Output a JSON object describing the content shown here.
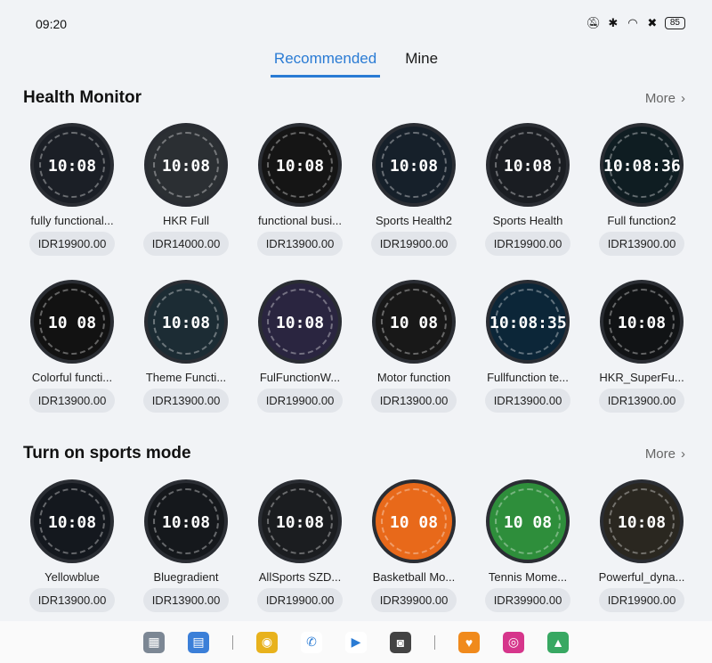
{
  "status": {
    "time": "09:20",
    "battery": "85"
  },
  "tabs": [
    {
      "label": "Recommended"
    },
    {
      "label": "Mine"
    }
  ],
  "sections": [
    {
      "title": "Health Monitor",
      "more": "More",
      "items": [
        {
          "name": "fully functional...",
          "price": "IDR19900.00",
          "bg": "#1b1f26",
          "time": "10:08"
        },
        {
          "name": "HKR Full",
          "price": "IDR14000.00",
          "bg": "#2b2f33",
          "time": "10:08"
        },
        {
          "name": "functional busi...",
          "price": "IDR13900.00",
          "bg": "#151515",
          "time": "10:08"
        },
        {
          "name": "Sports Health2",
          "price": "IDR19900.00",
          "bg": "#16202a",
          "time": "10:08"
        },
        {
          "name": "Sports Health",
          "price": "IDR19900.00",
          "bg": "#1a1d22",
          "time": "10:08"
        },
        {
          "name": "Full function2",
          "price": "IDR13900.00",
          "bg": "#0f1d22",
          "time": "10:08:36"
        },
        {
          "name": "Colorful functi...",
          "price": "IDR13900.00",
          "bg": "#121212",
          "time": "10 08"
        },
        {
          "name": "Theme Functi...",
          "price": "IDR13900.00",
          "bg": "#1c2c34",
          "time": "10:08"
        },
        {
          "name": "FulFunctionW...",
          "price": "IDR19900.00",
          "bg": "#2a2540",
          "time": "10:08"
        },
        {
          "name": "Motor function",
          "price": "IDR13900.00",
          "bg": "#181818",
          "time": "10 08"
        },
        {
          "name": "Fullfunction te...",
          "price": "IDR13900.00",
          "bg": "#0c2638",
          "time": "10:08:35"
        },
        {
          "name": "HKR_SuperFu...",
          "price": "IDR13900.00",
          "bg": "#111315",
          "time": "10:08"
        }
      ]
    },
    {
      "title": "Turn on sports mode",
      "more": "More",
      "items": [
        {
          "name": "Yellowblue",
          "price": "IDR13900.00",
          "bg": "#14181e",
          "time": "10:08"
        },
        {
          "name": "Bluegradient",
          "price": "IDR13900.00",
          "bg": "#15181c",
          "time": "10:08"
        },
        {
          "name": "AllSports SZD...",
          "price": "IDR19900.00",
          "bg": "#1b1d20",
          "time": "10:08"
        },
        {
          "name": "Basketball Mo...",
          "price": "IDR39900.00",
          "bg": "#e8691a",
          "time": "10 08"
        },
        {
          "name": "Tennis Mome...",
          "price": "IDR39900.00",
          "bg": "#2e8e3b",
          "time": "10 08"
        },
        {
          "name": "Powerful_dyna...",
          "price": "IDR19900.00",
          "bg": "#2a2720",
          "time": "10:08"
        }
      ]
    }
  ],
  "dock": [
    {
      "name": "app-grid-icon",
      "color": "#7c8794",
      "glyph": "▦"
    },
    {
      "name": "file-manager-icon",
      "color": "#3b7fd8",
      "glyph": "▤"
    },
    {
      "name": "chrome-icon",
      "color": "#e8b21c",
      "glyph": "◉"
    },
    {
      "name": "phone-icon",
      "color": "#ffffff",
      "glyph": "✆"
    },
    {
      "name": "play-store-icon",
      "color": "#ffffff",
      "glyph": "▶"
    },
    {
      "name": "camera-icon",
      "color": "#444444",
      "glyph": "◙"
    },
    {
      "name": "health-app-icon",
      "color": "#f08a1c",
      "glyph": "♥"
    },
    {
      "name": "instagram-icon",
      "color": "#d6368b",
      "glyph": "◎"
    },
    {
      "name": "gallery-icon",
      "color": "#38a862",
      "glyph": "▲"
    }
  ]
}
